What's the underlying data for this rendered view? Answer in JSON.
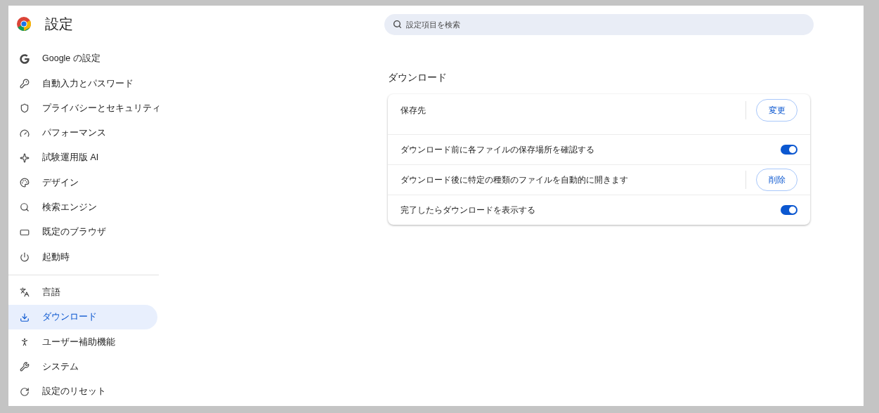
{
  "header": {
    "title": "設定"
  },
  "search": {
    "placeholder": "設定項目を検索"
  },
  "sidebar": {
    "groups": [
      {
        "items": [
          {
            "label": "Google の設定",
            "selected": false
          },
          {
            "label": "自動入力とパスワード",
            "selected": false
          },
          {
            "label": "プライバシーとセキュリティ",
            "selected": false
          },
          {
            "label": "パフォーマンス",
            "selected": false
          },
          {
            "label": "試験運用版 AI",
            "selected": false
          },
          {
            "label": "デザイン",
            "selected": false
          },
          {
            "label": "検索エンジン",
            "selected": false
          },
          {
            "label": "既定のブラウザ",
            "selected": false
          },
          {
            "label": "起動時",
            "selected": false
          }
        ]
      },
      {
        "items": [
          {
            "label": "言語",
            "selected": false
          },
          {
            "label": "ダウンロード",
            "selected": true
          },
          {
            "label": "ユーザー補助機能",
            "selected": false
          },
          {
            "label": "システム",
            "selected": false
          },
          {
            "label": "設定のリセット",
            "selected": false
          }
        ]
      }
    ]
  },
  "section": {
    "title": "ダウンロード",
    "rows": [
      {
        "kind": "button",
        "label": "保存先",
        "button": "変更"
      },
      {
        "kind": "toggle",
        "label": "ダウンロード前に各ファイルの保存場所を確認する",
        "on": true
      },
      {
        "kind": "button",
        "label": "ダウンロード後に特定の種類のファイルを自動的に開きます",
        "button": "削除"
      },
      {
        "kind": "toggle",
        "label": "完了したらダウンロードを表示する",
        "on": true
      }
    ]
  }
}
